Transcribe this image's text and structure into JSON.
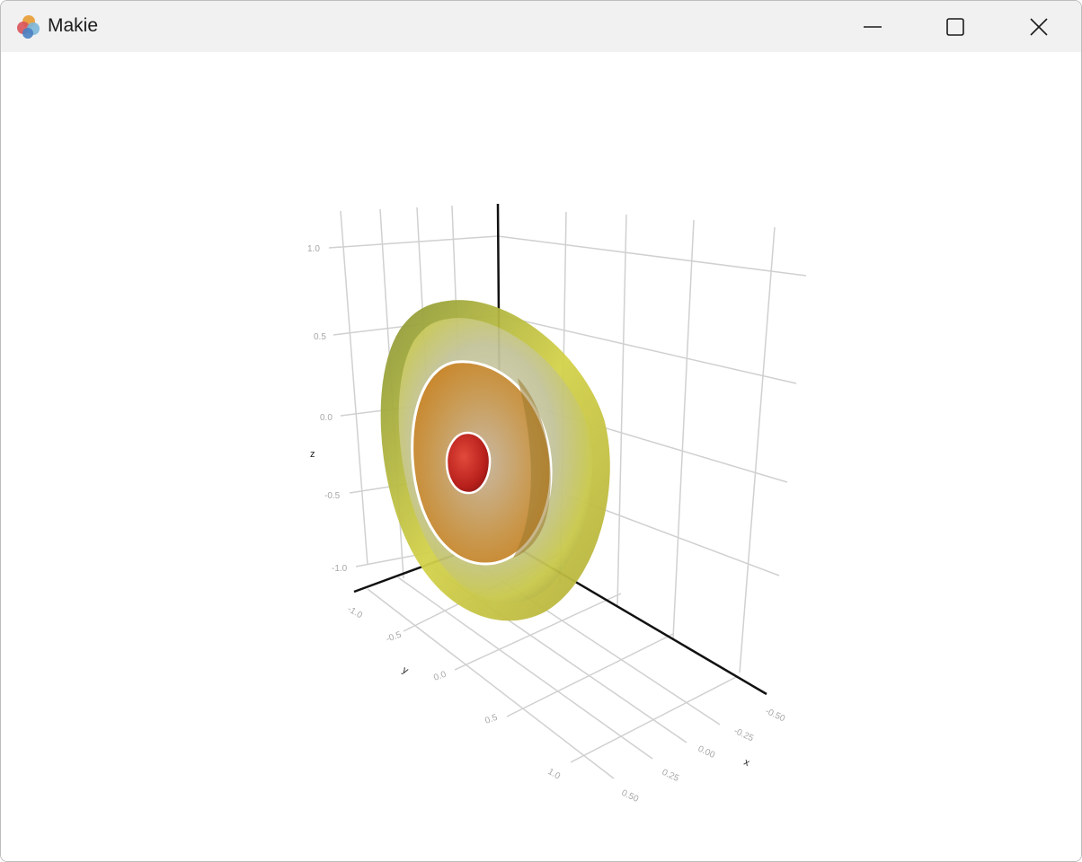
{
  "window": {
    "title": "Makie",
    "minimize_icon": "minimize-icon",
    "maximize_icon": "maximize-icon",
    "close_icon": "close-icon",
    "app_icon": "makie-logo-icon"
  },
  "plot": {
    "type": "3d-contour-volume",
    "axes": {
      "x": {
        "label": "x",
        "ticks": [
          "-0.50",
          "-0.25",
          "0.00",
          "0.25",
          "0.50"
        ]
      },
      "y": {
        "label": "y",
        "ticks": [
          "-1.0",
          "-0.5",
          "0.0",
          "0.5",
          "1.0"
        ]
      },
      "z": {
        "label": "z",
        "ticks": [
          "1.0",
          "0.5",
          "0.0",
          "-0.5",
          "-1.0"
        ]
      }
    },
    "colors": {
      "outer_shell": "#c8c84a",
      "middle_shell": "#d99a3a",
      "inner_core": "#c0231f",
      "grid": "#d3d3d3",
      "spine": "#111111"
    }
  }
}
